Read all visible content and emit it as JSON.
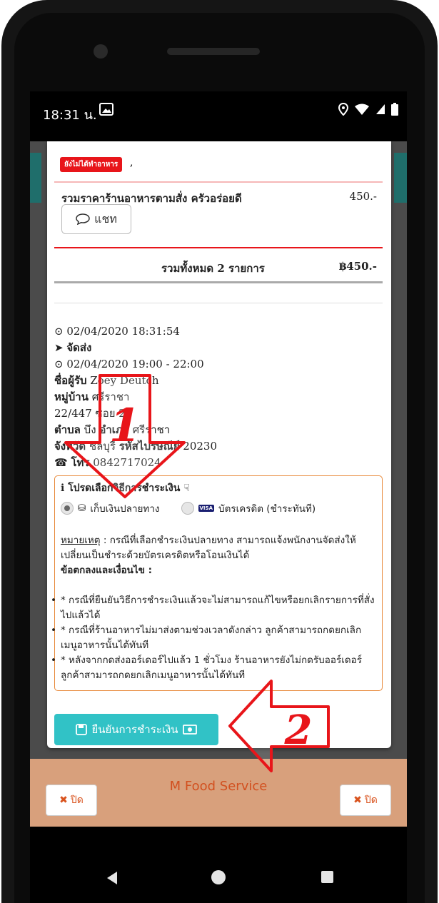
{
  "statusbar": {
    "time": "18:31 น."
  },
  "order": {
    "badge": "ยังไม่ได้ทำอาหาร",
    "restaurant_total_label": "รวมราคาร้านอาหารตามสั่ง ครัวอร่อยดี",
    "restaurant_total_value": "450.-",
    "chat_label": "แชท",
    "grand_total_label": "รวมทั้งหมด 2 รายการ",
    "grand_total_value": "฿450.-"
  },
  "details": {
    "order_datetime": "02/04/2020 18:31:54",
    "delivery_label": "จัดส่ง",
    "delivery_window": "02/04/2020 19:00 - 22:00",
    "receiver_label": "ชื่อผู้รับ",
    "receiver_name": "Zoey Deutch",
    "village_label": "หมู่บ้าน",
    "village_value": "ศรีราชา",
    "address": "22/447 ซอย 27",
    "subdistrict_label": "ตำบล",
    "subdistrict_value": "บึง",
    "district_label": "อำเภอ",
    "district_value": "ศรีราชา",
    "province_label": "จังหวัด",
    "province_value": "ชลบุรี",
    "postcode_label": "รหัสไปรษณีย์",
    "postcode_value": "20230",
    "phone_label": "โทร",
    "phone_value": "0842717024"
  },
  "payment": {
    "title": "โปรดเลือกวิธีการชำระเงิน",
    "option_cod": "เก็บเงินปลายทาง",
    "option_card": "บัตรเครดิต (ชำระทันที)",
    "selected": "cod",
    "note_label": "หมายเหตุ",
    "note_text": " : กรณีที่เลือกชำระเงินปลายทาง สามารถแจ้งพนักงานจัดส่งให้เปลี่ยนเป็นชำระด้วยบัตรเครดิตหรือโอนเงินได้",
    "terms_title": "ข้อตกลงและเงื่อนไข :",
    "terms": [
      "* กรณีที่ยืนยันวิธีการชำระเงินแล้วจะไม่สามารถแก้ไขหรือยกเลิกรายการที่สั่งไปแล้วได้",
      "* กรณีที่ร้านอาหารไม่มาส่งตามช่วงเวลาดังกล่าว ลูกค้าสามารถกดยกเลิกเมนูอาหารนั้นได้ทันที",
      "* หลังจากกดส่งออร์เดอร์ไปแล้ว 1 ชั่วโมง ร้านอาหารยังไม่กดรับออร์เดอร์ ลูกค้าสามารถกดยกเลิกเมนูอาหารนั้นได้ทันที"
    ]
  },
  "confirm_button": "ยืนยันการชำระเงิน",
  "footer": {
    "title": "M Food Service",
    "close_label": "ปิด"
  },
  "annotations": {
    "arrow1": "1",
    "arrow2": "2"
  },
  "colors": {
    "accent": "#31c2c6",
    "badge": "#e8151a",
    "annotation": "#e8151a",
    "border": "#e8893a"
  }
}
